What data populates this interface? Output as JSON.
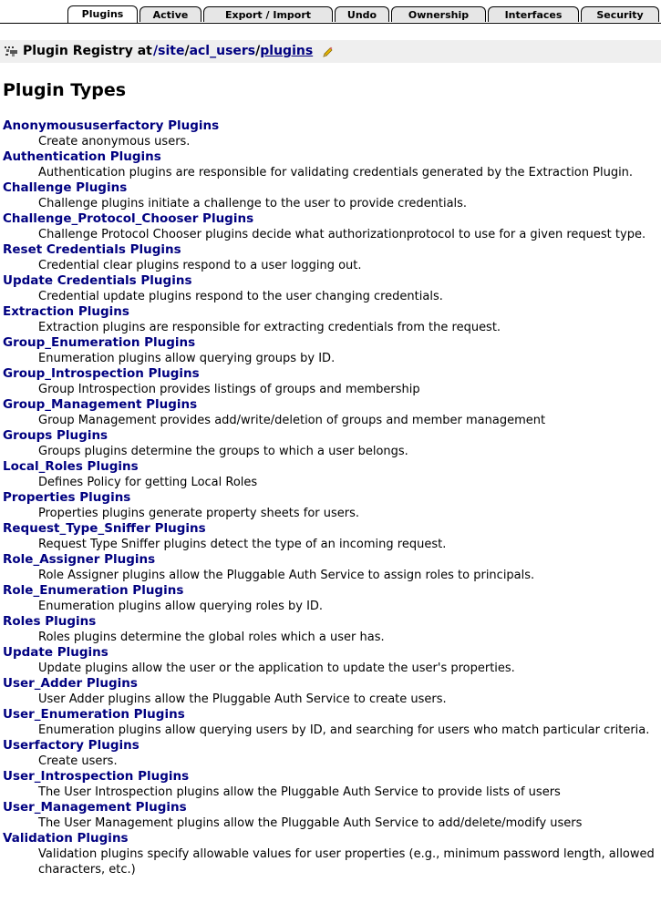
{
  "tabs": [
    {
      "label": "Plugins",
      "active": true
    },
    {
      "label": "Active",
      "active": false
    },
    {
      "label": "Export / Import",
      "active": false
    },
    {
      "label": "Undo",
      "active": false
    },
    {
      "label": "Ownership",
      "active": false
    },
    {
      "label": "Interfaces",
      "active": false
    },
    {
      "label": "Security",
      "active": false
    }
  ],
  "location": {
    "title": "Plugin Registry at",
    "path": [
      {
        "label": "/site"
      },
      {
        "label": "acl_users"
      },
      {
        "label": "plugins"
      }
    ]
  },
  "page_title": "Plugin Types",
  "plugin_types": [
    {
      "name": "Anonymoususerfactory Plugins",
      "desc": "Create anonymous users."
    },
    {
      "name": "Authentication Plugins",
      "desc": "Authentication plugins are responsible for validating credentials generated by the Extraction Plugin."
    },
    {
      "name": "Challenge Plugins",
      "desc": "Challenge plugins initiate a challenge to the user to provide credentials."
    },
    {
      "name": "Challenge_Protocol_Chooser Plugins",
      "desc": "Challenge Protocol Chooser plugins decide what authorizationprotocol to use for a given request type."
    },
    {
      "name": "Reset Credentials Plugins",
      "desc": "Credential clear plugins respond to a user logging out."
    },
    {
      "name": "Update Credentials Plugins",
      "desc": "Credential update plugins respond to the user changing credentials."
    },
    {
      "name": "Extraction Plugins",
      "desc": "Extraction plugins are responsible for extracting credentials from the request."
    },
    {
      "name": "Group_Enumeration Plugins",
      "desc": "Enumeration plugins allow querying groups by ID."
    },
    {
      "name": "Group_Introspection Plugins",
      "desc": "Group Introspection provides listings of groups and membership"
    },
    {
      "name": "Group_Management Plugins",
      "desc": "Group Management provides add/write/deletion of groups and member management"
    },
    {
      "name": "Groups Plugins",
      "desc": "Groups plugins determine the groups to which a user belongs."
    },
    {
      "name": "Local_Roles Plugins",
      "desc": "Defines Policy for getting Local Roles"
    },
    {
      "name": "Properties Plugins",
      "desc": "Properties plugins generate property sheets for users."
    },
    {
      "name": "Request_Type_Sniffer Plugins",
      "desc": "Request Type Sniffer plugins detect the type of an incoming request."
    },
    {
      "name": "Role_Assigner Plugins",
      "desc": "Role Assigner plugins allow the Pluggable Auth Service to assign roles to principals."
    },
    {
      "name": "Role_Enumeration Plugins",
      "desc": "Enumeration plugins allow querying roles by ID."
    },
    {
      "name": "Roles Plugins",
      "desc": "Roles plugins determine the global roles which a user has."
    },
    {
      "name": "Update Plugins",
      "desc": "Update plugins allow the user or the application to update the user's properties."
    },
    {
      "name": "User_Adder Plugins",
      "desc": "User Adder plugins allow the Pluggable Auth Service to create users."
    },
    {
      "name": "User_Enumeration Plugins",
      "desc": "Enumeration plugins allow querying users by ID, and searching for users who match particular criteria."
    },
    {
      "name": "Userfactory Plugins",
      "desc": "Create users."
    },
    {
      "name": "User_Introspection Plugins",
      "desc": "The User Introspection plugins allow the Pluggable Auth Service to provide lists of users"
    },
    {
      "name": "User_Management Plugins",
      "desc": "The User Management plugins allow the Pluggable Auth Service to add/delete/modify users"
    },
    {
      "name": "Validation Plugins",
      "desc": "Validation plugins specify allowable values for user properties (e.g., minimum password length, allowed characters, etc.)"
    }
  ]
}
